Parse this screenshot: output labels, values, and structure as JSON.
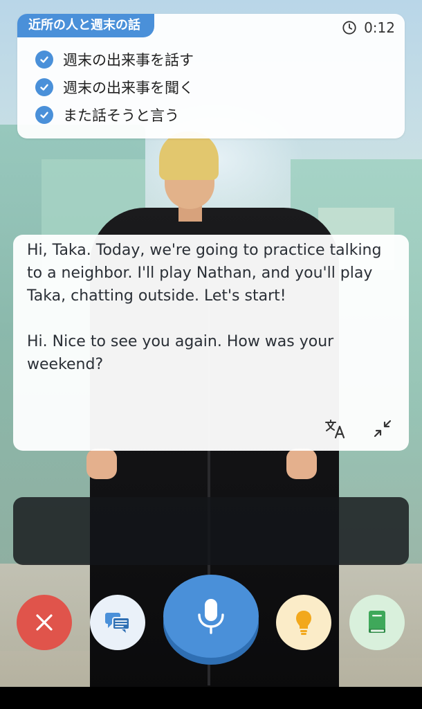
{
  "task_card": {
    "title": "近所の人と週末の話",
    "timer": "0:12",
    "tasks": [
      {
        "label": "週末の出来事を話す",
        "done": true
      },
      {
        "label": "週末の出来事を聞く",
        "done": true
      },
      {
        "label": "また話そうと言う",
        "done": true
      }
    ],
    "accent_color": "#4a90d9"
  },
  "speech_bubble": {
    "paragraph_1": "Hi, Taka. Today, we're going to practice talking to a neighbor. I'll play Nathan, and you'll play Taka, chatting outside. Let's start!",
    "paragraph_2": "Hi. Nice to see you again. How was your weekend?",
    "icons": [
      "translate-icon",
      "collapse-icon"
    ]
  },
  "transcript_panel": {
    "text": ""
  },
  "controls": {
    "close": {
      "icon": "close-icon",
      "color": "#e0544b"
    },
    "chat": {
      "icon": "chat-icon",
      "color": "#eaf1f9"
    },
    "mic": {
      "icon": "microphone-icon",
      "color": "#4a90d9"
    },
    "hint": {
      "icon": "lightbulb-icon",
      "color": "#fbecc8"
    },
    "book": {
      "icon": "book-icon",
      "color": "#d9f0dc"
    }
  }
}
